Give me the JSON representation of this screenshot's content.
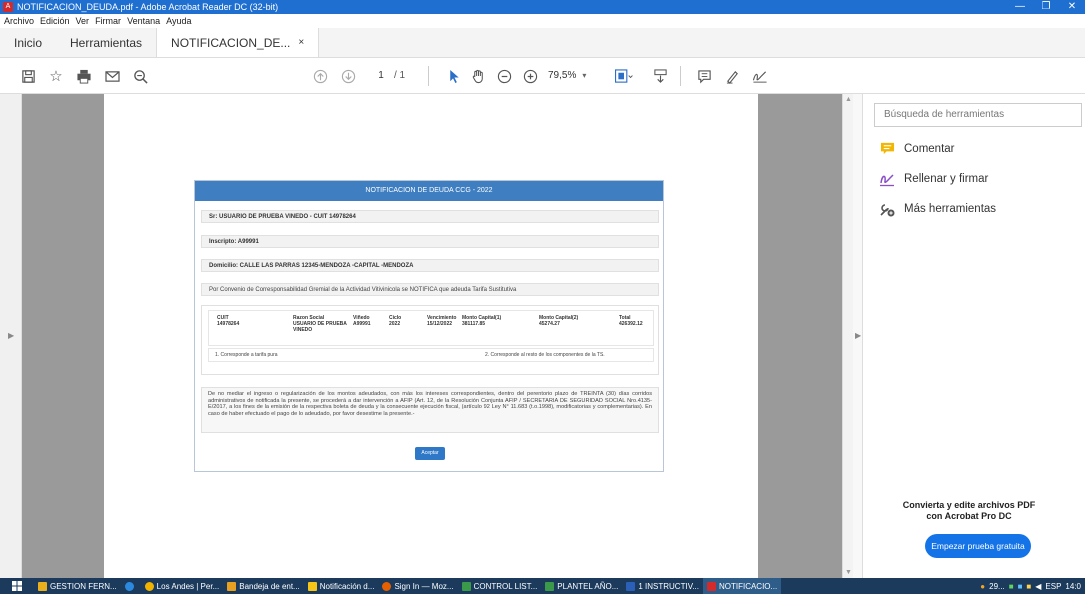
{
  "window": {
    "title": "NOTIFICACION_DEUDA.pdf - Adobe Acrobat Reader DC (32-bit)",
    "minimize": "—",
    "maximize": "❐",
    "close": "✕"
  },
  "menu": [
    "Archivo",
    "Edición",
    "Ver",
    "Firmar",
    "Ventana",
    "Ayuda"
  ],
  "tabs": {
    "home": "Inicio",
    "tools": "Herramientas",
    "document": "NOTIFICACION_DE...",
    "close": "×"
  },
  "toolbar": {
    "page_current": "1",
    "page_total": "/ 1",
    "zoom": "79,5%"
  },
  "document": {
    "header": "NOTIFICACION DE DEUDA CCG - 2022",
    "recipient": "Sr: USUARIO DE PRUEBA VINEDO - CUIT 14978264",
    "inscripto": "Inscripto: A99991",
    "domicilio": "Domicilio: CALLE LAS PARRAS 12345-MENDOZA -CAPITAL -MENDOZA",
    "convenio": "Por Convenio de Corresponsabilidad Gremial de la Actividad Vitivinicola se NOTIFICA que adeuda Tarifa Sustitutiva",
    "table": {
      "cuit_h": "CUIT",
      "cuit_v": "14978264",
      "razon_h": "Razon Social",
      "razon_v1": "USUARIO DE PRUEBA",
      "razon_v2": "VINEDO",
      "vinedo_h": "Viñedo",
      "vinedo_v": "A99991",
      "ciclo_h": "Ciclo",
      "ciclo_v": "2022",
      "venc_h": "Vencimiento",
      "venc_v": "15/12/2022",
      "cap1_h": "Monto Capital(1)",
      "cap1_v": "381117.85",
      "cap2_h": "Monto Capital(2)",
      "cap2_v": "45274.27",
      "total_h": "Total",
      "total_v": "426392.12"
    },
    "note1": "1. Corresponde a tarifa pura",
    "note2": "2. Corresponde al resto de los componentes de la TS.",
    "legal": "De no mediar el ingreso o regularización de los montos adeudados, con más los intereses correspondientes, dentro del perentorio plazo de TREINTA (30) días corridos administrativos de notificada la presente, se procederá a dar intervención a AFIP (Art. 12, de la Resolución Conjunta AFIP / SECRETARIA DE SEGURIDAD SOCIAL Nro.4135-E/2017, a los fines de la emisión de la respectiva boleta de deuda y la consecuente ejecución fiscal, (artículo 92 Ley N° 11.683 (t.o.1998), modificatorias y complementarias). En caso de haber efectuado el pago de lo adeudado, por favor desestime la presente.-",
    "accept": "Aceptar"
  },
  "rpanel": {
    "search_placeholder": "Búsqueda de herramientas",
    "tool1": "Comentar",
    "tool2": "Rellenar y firmar",
    "tool3": "Más herramientas",
    "promo_line1": "Convierta y edite archivos PDF",
    "promo_line2": "con Acrobat Pro DC",
    "promo_btn": "Empezar prueba gratuita"
  },
  "taskbar": {
    "items": [
      "GESTION FERN...",
      "Los Andes | Per...",
      "Bandeja de ent...",
      "Notificación d...",
      "Sign In — Moz...",
      "CONTROL LIST...",
      "PLANTEL AÑO...",
      "1 INSTRUCTIV...",
      "NOTIFICACIO..."
    ],
    "weather": "29...",
    "lang": "ESP",
    "time": "14:0"
  },
  "colors": {
    "accent": "#1473e6",
    "titlebar": "#1f6fd0",
    "doc_header": "#3f7fc1",
    "comment_icon": "#f2b705",
    "fill_sign_icon": "#8a4fc7"
  }
}
